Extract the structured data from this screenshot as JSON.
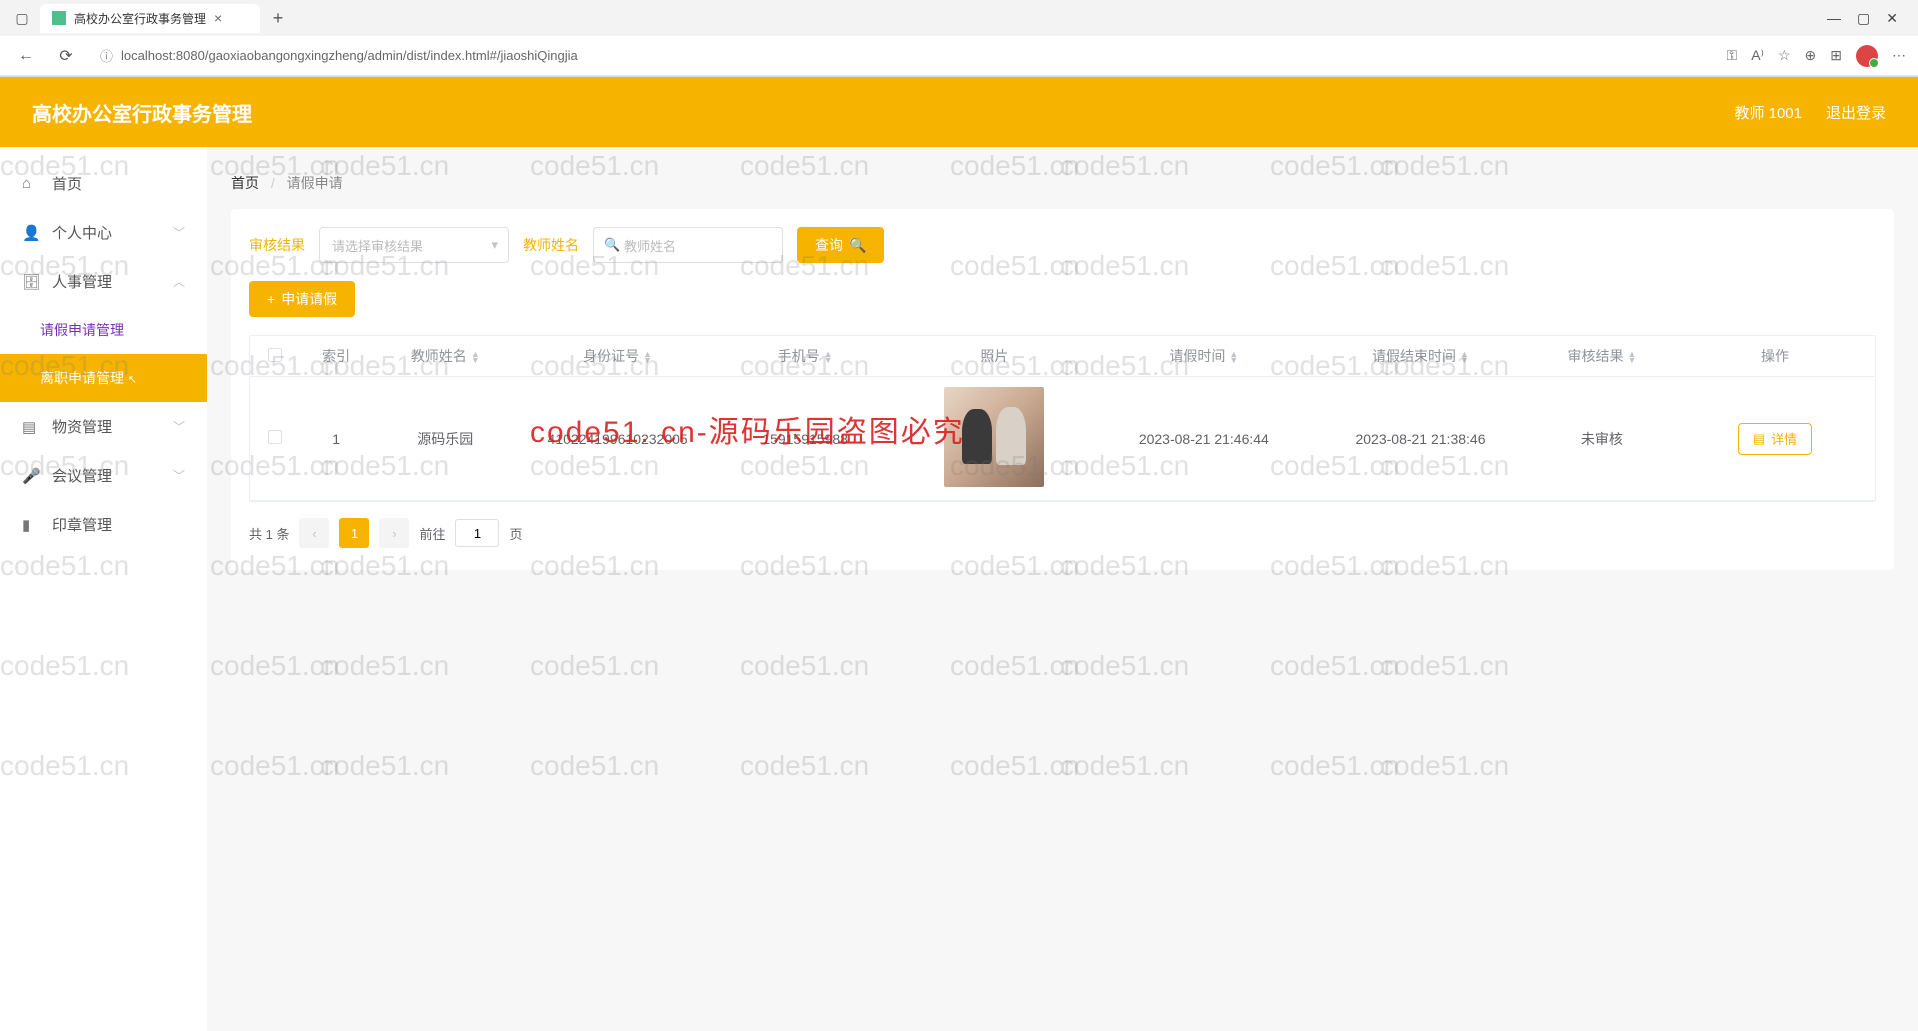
{
  "browser": {
    "tab_title": "高校办公室行政事务管理",
    "url": "localhost:8080/gaoxiaobangongxingzheng/admin/dist/index.html#/jiaoshiQingjia"
  },
  "header": {
    "title": "高校办公室行政事务管理",
    "user": "教师 1001",
    "logout": "退出登录"
  },
  "sidebar": {
    "home": "首页",
    "profile": "个人中心",
    "hr": "人事管理",
    "hr_sub": {
      "leave_apply": "请假申请管理",
      "resign_apply": "离职申请管理"
    },
    "material": "物资管理",
    "meeting": "会议管理",
    "stamp": "印章管理"
  },
  "breadcrumb": {
    "home": "首页",
    "current": "请假申请"
  },
  "filters": {
    "label_result": "审核结果",
    "placeholder_result": "请选择审核结果",
    "label_name": "教师姓名",
    "placeholder_name": "教师姓名",
    "search_btn": "查询",
    "add_btn": "申请请假"
  },
  "table": {
    "columns": {
      "index": "索引",
      "teacher": "教师姓名",
      "idcard": "身份证号",
      "phone": "手机号",
      "photo": "照片",
      "start": "请假时间",
      "end": "请假结束时间",
      "result": "审核结果",
      "ops": "操作"
    },
    "rows": [
      {
        "index": "1",
        "teacher": "源码乐园",
        "idcard": "41022419961023​2005",
        "phone": "15915915988",
        "start": "2023-08-21 21:46:44",
        "end": "2023-08-21 21:38:46",
        "result": "未审核",
        "detail_btn": "详情"
      }
    ]
  },
  "pagination": {
    "total": "共 1 条",
    "current": "1",
    "goto_prefix": "前往",
    "goto_value": "1",
    "goto_suffix": "页"
  },
  "watermarks": {
    "text": "code51.cn",
    "red": "code51. cn-源码乐园盗图必究"
  }
}
